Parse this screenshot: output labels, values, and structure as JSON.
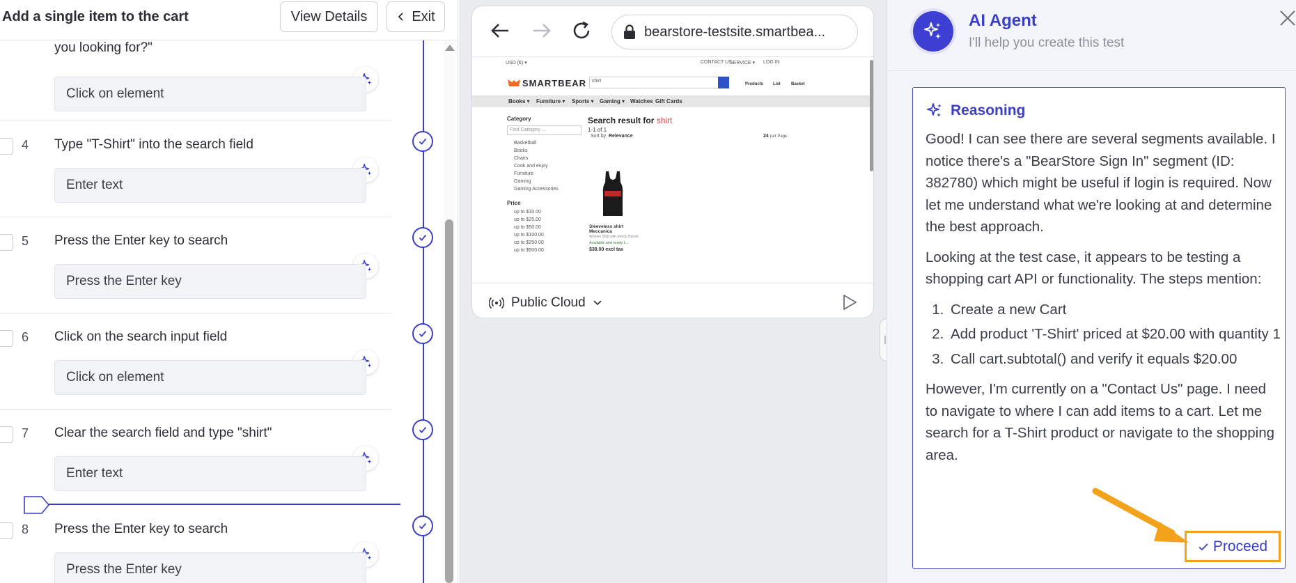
{
  "left": {
    "title": "Add a single item to the cart",
    "view_details": "View Details",
    "exit": "Exit",
    "partial_step_text": "you looking for?\"",
    "partial_step_action": "Click on element",
    "steps": [
      {
        "num": "4",
        "text": "Type \"T-Shirt\" into the search field",
        "action": "Enter text"
      },
      {
        "num": "5",
        "text": "Press the Enter key to search",
        "action": "Press the Enter key"
      },
      {
        "num": "6",
        "text": "Click on the search input field",
        "action": "Click on element"
      },
      {
        "num": "7",
        "text": "Clear the search field and type \"shirt\"",
        "action": "Enter text"
      },
      {
        "num": "8",
        "text": "Press the Enter key to search",
        "action": "Press the Enter key"
      }
    ]
  },
  "browser": {
    "url": "bearstore-testsite.smartbea...",
    "cloud": "Public Cloud",
    "page": {
      "top_left": "USD  (₤) ▾",
      "top_right_1": "CONTACT US",
      "top_right_2": "SERVICE ▾",
      "top_right_3": "LOG IN",
      "logo": "SMARTBEAR",
      "search_value": "shirt",
      "hdr_1": "Products",
      "hdr_2": "List",
      "hdr_3": "Basket",
      "menu": [
        "Books ▾",
        "Furniture ▾",
        "Sports ▾",
        "Gaming ▾",
        "Watches",
        "Gift Cards"
      ],
      "results_title": "Search result for",
      "results_term": "shirt",
      "results_count": "1-1 of 1",
      "category": "Category",
      "filter_placeholder": "Find Category ...",
      "categories": [
        "Basketball",
        "Books",
        "Chairs",
        "Cook and enjoy",
        "Furniture",
        "Gaming",
        "Gaming Accessories"
      ],
      "price": "Price",
      "prices": [
        "up to $10.00",
        "up to $25.00",
        "up to $50.00",
        "up to $100.00",
        "up to $250.00",
        "up to $500.00"
      ],
      "sort_label": "Sort by",
      "sort_value": "Relevance",
      "per_page": "24",
      "per_page_label": "per Page",
      "product_name_1": "Sleeveless shirt",
      "product_name_2": "Meccanica",
      "product_desc": "Women Shirt with trendy imprint",
      "product_stock": "Available and ready t...",
      "product_price": "$38.00 excl tax"
    }
  },
  "agent": {
    "title": "AI Agent",
    "subtitle": "I'll help you create this test",
    "reasoning_title": "Reasoning",
    "p1": "Good! I can see there are several segments available. I notice there's a \"BearStore Sign In\" segment (ID: 382780) which might be useful if login is required. Now let me understand what we're looking at and determine the best approach.",
    "p2": "Looking at the test case, it appears to be testing a shopping cart API or functionality. The steps mention:",
    "list": [
      "Create a new Cart",
      "Add product 'T-Shirt' priced at $20.00 with quantity 1",
      "Call cart.subtotal() and verify it equals $20.00"
    ],
    "p3": "However, I'm currently on a \"Contact Us\" page. I need to navigate to where I can add items to a cart. Let me search for a T-Shirt product or navigate to the shopping area.",
    "proceed": "Proceed"
  },
  "colors": {
    "accent": "#3b3fc4",
    "highlight": "#f2a21b"
  }
}
